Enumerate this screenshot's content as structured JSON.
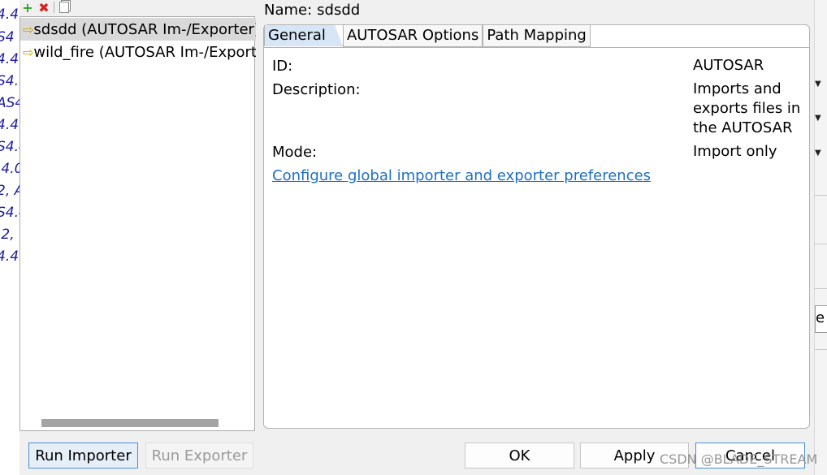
{
  "background": {
    "left_fragments": [
      "4.4",
      "S4",
      "4.4",
      "S4.",
      "AS4",
      "4.4",
      "S4.4",
      ".4.0",
      "2, A",
      "S4.4",
      ".2,",
      "4.4."
    ],
    "right_cell_text": "e"
  },
  "toolbar": {
    "icons": [
      "add-icon",
      "remove-icon",
      "copy-icon"
    ]
  },
  "list": {
    "items": [
      {
        "label": "sdsdd (AUTOSAR Im-/Exporter)",
        "selected": true
      },
      {
        "label": "wild_fire (AUTOSAR Im-/Exporter)",
        "selected": false
      }
    ]
  },
  "name": {
    "label": "Name:",
    "value": "sdsdd"
  },
  "tabs": [
    {
      "label": "General",
      "active": true
    },
    {
      "label": "AUTOSAR Options",
      "active": false
    },
    {
      "label": "Path Mapping",
      "active": false
    }
  ],
  "general": {
    "id_label": "ID:",
    "id_value": "AUTOSAR",
    "description_label": "Description:",
    "description_value": "Imports and exports files in the AUTOSAR",
    "mode_label": "Mode:",
    "mode_value": "Import only",
    "link_text": "Configure global importer and exporter preferences"
  },
  "buttons": {
    "run_importer": "Run Importer",
    "run_exporter": "Run Exporter",
    "ok": "OK",
    "apply": "Apply",
    "cancel": "Cancel"
  },
  "watermark": "CSDN @BLADE_STREAM",
  "colors": {
    "link": "#1c6fc6",
    "active_tab": "#d6e6f6",
    "focus_border": "#4a8fd8"
  }
}
